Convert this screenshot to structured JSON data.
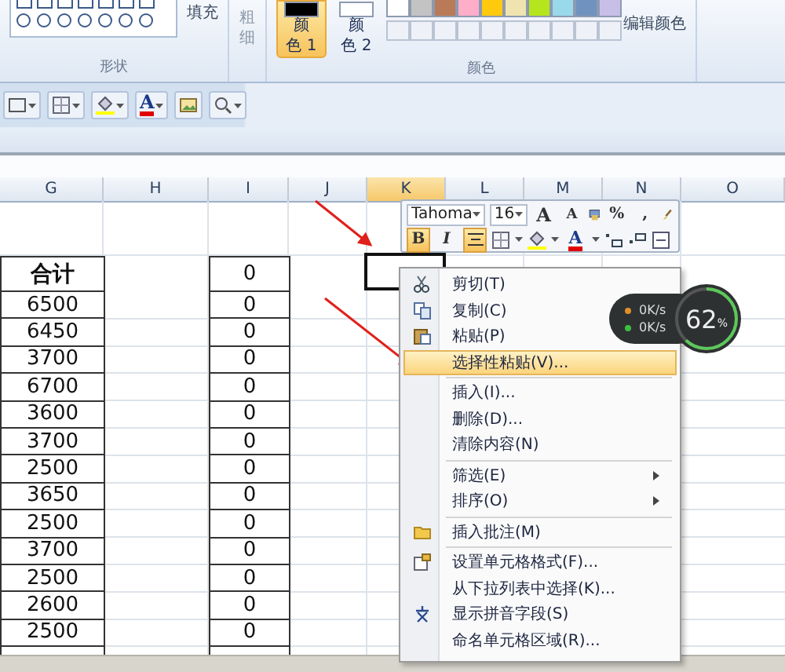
{
  "ribbon": {
    "fill_label": "填充",
    "thickness_label": "粗细",
    "color1": {
      "label": "颜色 1",
      "selected": true
    },
    "color2": {
      "label": "颜色 2",
      "selected": false
    },
    "palette": [
      {
        "color": "#ffffff"
      },
      {
        "color": "#c3c3c3"
      },
      {
        "color": "#b97a57"
      },
      {
        "color": "#ffaec9"
      },
      {
        "color": "#ffc90e"
      },
      {
        "color": "#efe4b0"
      },
      {
        "color": "#b5e61d"
      },
      {
        "color": "#99d9ea"
      },
      {
        "color": "#7092be"
      },
      {
        "color": "#c8bfe7"
      }
    ],
    "edit_colors_label": "编辑颜色",
    "shapes_group_label": "形状",
    "colors_group_label": "颜色"
  },
  "toolbar": {
    "font_color_label": "A"
  },
  "sheet": {
    "columns": [
      {
        "label": "G",
        "selected": false
      },
      {
        "label": "H",
        "selected": false
      },
      {
        "label": "I",
        "selected": false
      },
      {
        "label": "J",
        "selected": false
      },
      {
        "label": "K",
        "selected": true
      },
      {
        "label": "L",
        "selected": false
      },
      {
        "label": "M",
        "selected": false
      },
      {
        "label": "N",
        "selected": false
      },
      {
        "label": "O",
        "selected": false
      }
    ],
    "rows": [
      {
        "kind": "heading",
        "total": "合计",
        "column_i": "0"
      },
      {
        "kind": "value",
        "total": "6500",
        "column_i": "0"
      },
      {
        "kind": "value",
        "total": "6450",
        "column_i": "0"
      },
      {
        "kind": "value",
        "total": "3700",
        "column_i": "0"
      },
      {
        "kind": "value",
        "total": "6700",
        "column_i": "0"
      },
      {
        "kind": "value",
        "total": "3600",
        "column_i": "0"
      },
      {
        "kind": "value",
        "total": "3700",
        "column_i": "0"
      },
      {
        "kind": "value",
        "total": "2500",
        "column_i": "0"
      },
      {
        "kind": "value",
        "total": "3650",
        "column_i": "0"
      },
      {
        "kind": "value",
        "total": "2500",
        "column_i": "0"
      },
      {
        "kind": "value",
        "total": "3700",
        "column_i": "0"
      },
      {
        "kind": "value",
        "total": "2500",
        "column_i": "0"
      },
      {
        "kind": "value",
        "total": "2600",
        "column_i": "0"
      },
      {
        "kind": "value",
        "total": "2500",
        "column_i": "0"
      }
    ]
  },
  "mini_toolbar": {
    "font": "Tahoma",
    "size": "16",
    "grow_label": "A",
    "shrink_label": "A",
    "percent_label": "%",
    "comma_label": ",",
    "bold": {
      "label": "B",
      "on": true
    },
    "italic": {
      "label": "I",
      "on": false
    },
    "center_on": true,
    "font_color_label": "A"
  },
  "context_menu": {
    "items": [
      {
        "kind": "command",
        "label": "剪切(T)",
        "selected": false,
        "separator_before": false
      },
      {
        "kind": "command",
        "label": "复制(C)",
        "selected": false,
        "separator_before": false
      },
      {
        "kind": "command",
        "label": "粘贴(P)",
        "selected": false,
        "separator_before": false
      },
      {
        "kind": "command",
        "label": "选择性粘贴(V)...",
        "selected": true,
        "separator_before": false
      },
      {
        "kind": "command",
        "label": "插入(I)...",
        "selected": false,
        "separator_before": true
      },
      {
        "kind": "command",
        "label": "删除(D)...",
        "selected": false,
        "separator_before": false
      },
      {
        "kind": "command",
        "label": "清除内容(N)",
        "selected": false,
        "separator_before": false
      },
      {
        "kind": "submenu",
        "label": "筛选(E)",
        "selected": false,
        "separator_before": true
      },
      {
        "kind": "submenu",
        "label": "排序(O)",
        "selected": false,
        "separator_before": false
      },
      {
        "kind": "command",
        "label": "插入批注(M)",
        "selected": false,
        "separator_before": true
      },
      {
        "kind": "command",
        "label": "设置单元格格式(F)...",
        "selected": false,
        "separator_before": true
      },
      {
        "kind": "command",
        "label": "从下拉列表中选择(K)...",
        "selected": false,
        "separator_before": false
      },
      {
        "kind": "command",
        "label": "显示拼音字段(S)",
        "selected": false,
        "separator_before": false
      },
      {
        "kind": "command",
        "label": "命名单元格区域(R)...",
        "selected": false,
        "separator_before": false
      }
    ]
  },
  "speed_widget": {
    "upload": "0K/s",
    "download": "0K/s",
    "percent": "62",
    "unit": "%",
    "level": 0.62
  }
}
